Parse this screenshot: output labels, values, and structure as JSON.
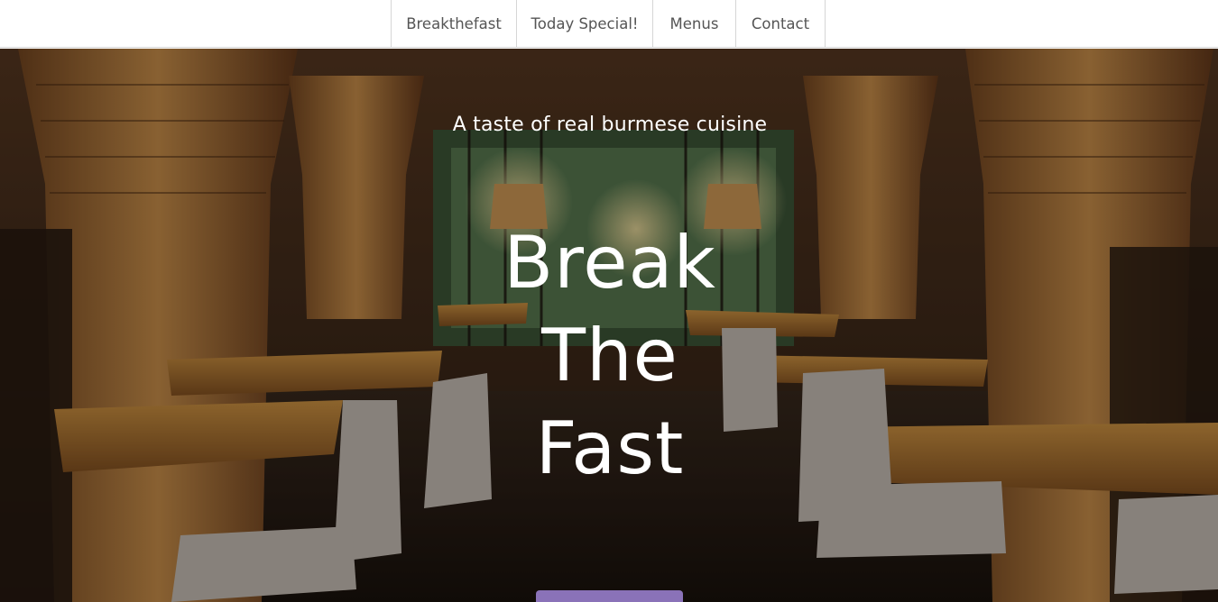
{
  "nav": {
    "items": [
      {
        "label": "Breakthefast"
      },
      {
        "label": "Today Special!"
      },
      {
        "label": "Menus"
      },
      {
        "label": "Contact"
      }
    ]
  },
  "hero": {
    "tagline": "A taste of real burmese cuisine",
    "title_lines": [
      "Break",
      "The",
      "Fast"
    ],
    "background": "restaurant-interior-photo",
    "cta_color": "#8a72b8"
  }
}
